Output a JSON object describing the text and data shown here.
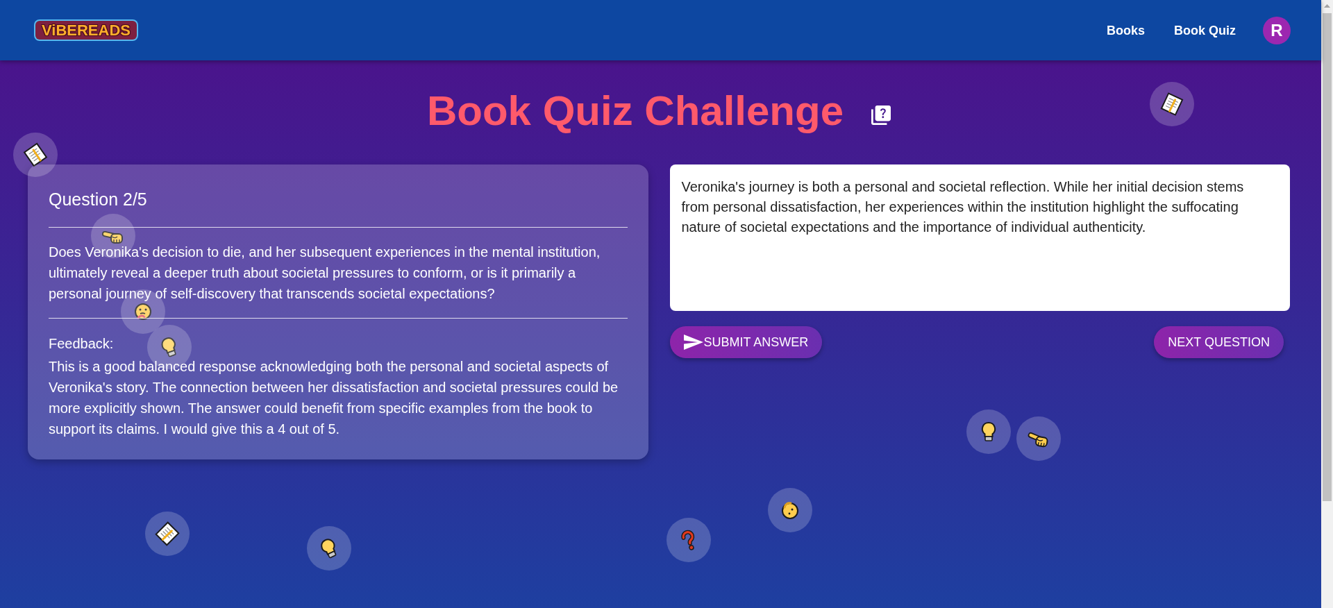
{
  "header": {
    "logo": "ViBEREADS",
    "nav": [
      {
        "label": "Books"
      },
      {
        "label": "Book Quiz"
      }
    ],
    "avatar": "R"
  },
  "title": "Book Quiz Challenge",
  "question_card": {
    "heading": "Question 2/5",
    "question": "Does Veronika's decision to die, and her subsequent experiences in the mental institution, ultimately reveal a deeper truth about societal pressures to conform, or is it primarily a personal journey of self-discovery that transcends societal expectations?",
    "feedback_label": "Feedback:",
    "feedback": "This is a good balanced response acknowledging both the personal and societal aspects of Veronika's story. The connection between her dissatisfaction and societal pressures could be more explicitly shown. The answer could benefit from specific examples from the book to support its claims. I would give this a 4 out of 5."
  },
  "answer": {
    "value": "Veronika's journey is both a personal and societal reflection. While her initial decision stems from personal dissatisfaction, her experiences within the institution highlight the suffocating nature of societal expectations and the importance of individual authenticity."
  },
  "buttons": [
    {
      "label": "SUBMIT ANSWER",
      "kind": "submit"
    },
    {
      "label": "NEXT QUESTION",
      "kind": "next"
    }
  ]
}
